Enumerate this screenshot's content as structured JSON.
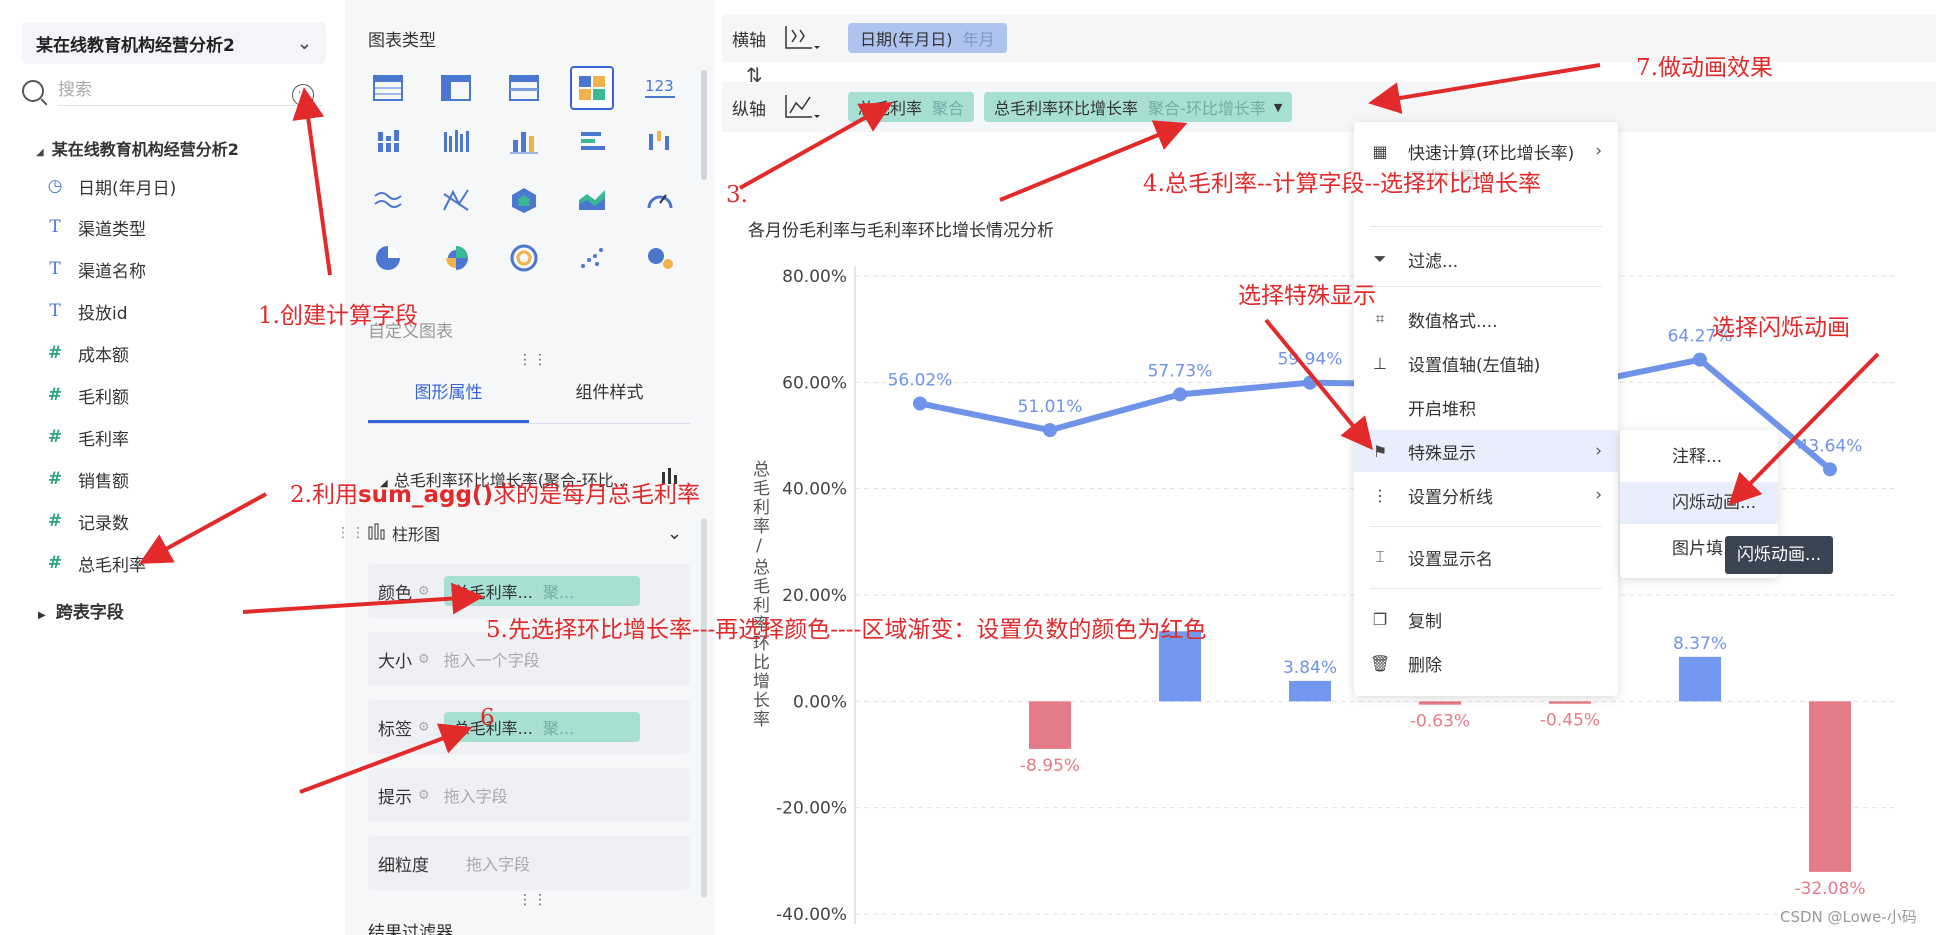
{
  "left": {
    "dataset": "某在线教育机构经营分析2",
    "search_placeholder": "搜索",
    "tree_root": "某在线教育机构经营分析2",
    "fields": [
      {
        "icon": "date",
        "label": "日期(年月日)"
      },
      {
        "icon": "text",
        "label": "渠道类型"
      },
      {
        "icon": "text",
        "label": "渠道名称"
      },
      {
        "icon": "text",
        "label": "投放id"
      },
      {
        "icon": "num",
        "label": "成本额"
      },
      {
        "icon": "num",
        "label": "毛利额"
      },
      {
        "icon": "num",
        "label": "毛利率"
      },
      {
        "icon": "num",
        "label": "销售额"
      },
      {
        "icon": "num",
        "label": "记录数"
      },
      {
        "icon": "calc",
        "label": "总毛利率"
      }
    ],
    "cross_fields": "跨表字段"
  },
  "middle": {
    "chart_type_title": "图表类型",
    "custom_chart": "自定义图表",
    "tabs": [
      "图形属性",
      "组件样式"
    ],
    "measure_title": "总毛利率环比增长率(聚合-环比...",
    "chart_selector": "柱形图",
    "props": [
      {
        "label": "颜色",
        "pill": "总毛利率...",
        "agg": "聚..."
      },
      {
        "label": "大小",
        "placeholder": "拖入一个字段"
      },
      {
        "label": "标签",
        "pill": "总毛利率...",
        "agg": "聚..."
      },
      {
        "label": "提示",
        "placeholder": "拖入字段"
      },
      {
        "label": "细粒度",
        "placeholder": "拖入字段"
      }
    ],
    "bottom": "结果过滤器"
  },
  "axes": {
    "x_label": "横轴",
    "x_pill": {
      "name": "日期(年月日)",
      "agg": "年月"
    },
    "y_label": "纵轴",
    "y_pills": [
      {
        "name": "总毛利率",
        "agg": "聚合"
      },
      {
        "name": "总毛利率环比增长率",
        "agg": "聚合-环比增长率"
      }
    ]
  },
  "chart_data": {
    "type": "bar+line",
    "title": "各月份毛利率与毛利率环比增长情况分析",
    "ylabel": "总毛利率/总毛利率环比增长率",
    "ylim": [
      -40,
      80
    ],
    "yticks": [
      "80.00%",
      "60.00%",
      "40.00%",
      "20.00%",
      "0.00%",
      "-20.00%",
      "-40.00%"
    ],
    "line_series": {
      "name": "总毛利率",
      "values": [
        56.02,
        51.01,
        57.73,
        59.94,
        59.57,
        59.3,
        64.27,
        43.64
      ]
    },
    "line_labels": [
      "56.02%",
      "51.01%",
      "57.73%",
      "59.94%",
      "%",
      "64.27%",
      "43.64%"
    ],
    "bar_series": {
      "name": "总毛利率环比增长率",
      "values": [
        -8.95,
        13.17,
        3.84,
        -0.63,
        -0.45,
        8.37,
        -32.08
      ]
    },
    "bar_labels": [
      "-8.95%",
      "3.84%",
      "-0.63%",
      "-0.45%",
      "8.37%",
      "-32.08%"
    ],
    "colors": {
      "line": "#6f93e8",
      "bar_pos": "#7197ef",
      "bar_neg": "#e57b88"
    }
  },
  "menu": {
    "items": [
      {
        "icon": "calc",
        "label": "快速计算(环比增长率)",
        "arrow": true
      },
      {
        "icon": "",
        "label": "二次计算",
        "disabled": true
      },
      {
        "icon": "filter",
        "label": "过滤..."
      },
      {
        "icon": "format",
        "label": "数值格式...."
      },
      {
        "icon": "axis",
        "label": "设置值轴(左值轴)"
      },
      {
        "icon": "",
        "label": "开启堆积"
      },
      {
        "icon": "flag",
        "label": "特殊显示",
        "arrow": true
      },
      {
        "icon": "line",
        "label": "设置分析线",
        "arrow": true
      },
      {
        "icon": "rename",
        "label": "设置显示名"
      },
      {
        "icon": "copy",
        "label": "复制"
      },
      {
        "icon": "delete",
        "label": "删除"
      }
    ],
    "submenu": [
      "注释...",
      "闪烁动画...",
      "图片填..."
    ],
    "tooltip": "闪烁动画..."
  },
  "annotations": {
    "a1": "1.创建计算字段",
    "a2_num": "2.利用",
    "a2_fn": "sum_agg()",
    "a2_rest": "求的是每月总毛利率",
    "a3": "3.",
    "a4": "4.总毛利率--计算字段--选择环比增长率",
    "a5": "5.先选择环比增长率---再选择颜色----区域渐变：设置负数的颜色为红色",
    "a6": "6",
    "a7": "7.做动画效果",
    "special": "选择特殊显示",
    "flash": "选择闪烁动画"
  },
  "watermark": "CSDN @Lowe-小码"
}
